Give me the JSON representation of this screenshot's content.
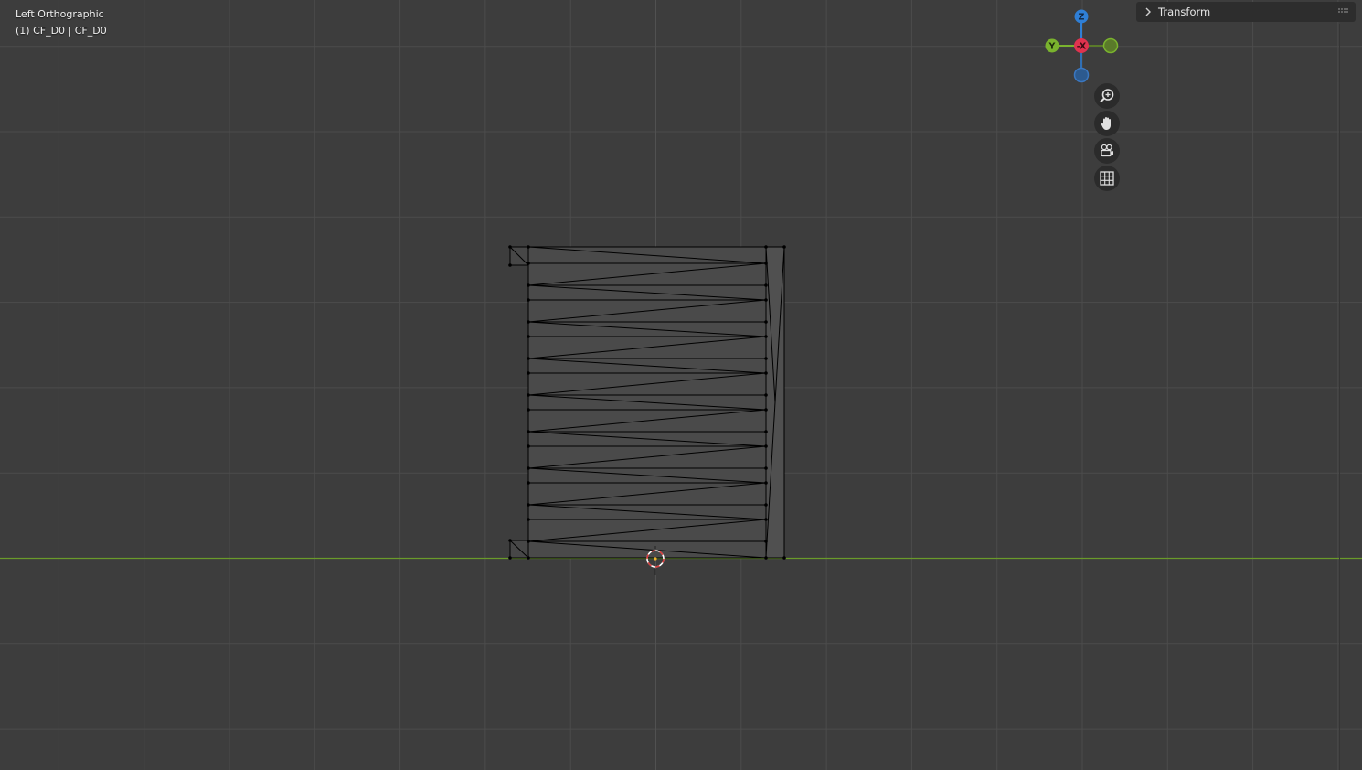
{
  "viewport": {
    "view_name": "Left Orthographic",
    "object_info": "(1) CF_D0 | CF_D0"
  },
  "gizmo": {
    "z_label": "Z",
    "y_label": "Y",
    "x_label": "-X",
    "colors": {
      "z": "#2f7fd6",
      "y": "#7ab32e",
      "x": "#e0334f",
      "neg_y": "#5a7a2a",
      "neg_z": "#2c5a8f"
    }
  },
  "nav_buttons": [
    {
      "name": "zoom-icon"
    },
    {
      "name": "pan-hand-icon"
    },
    {
      "name": "camera-icon"
    },
    {
      "name": "ortho-grid-icon"
    }
  ],
  "sidebar": {
    "panel_label": "Transform"
  },
  "colors": {
    "background": "#3d3d3d",
    "grid_minor": "#444444",
    "grid_major": "#4c4c4c",
    "horizon_axis": "#6a9a2a",
    "mesh_face": "#4a4a4a",
    "mesh_edge": "#000000",
    "cursor_red": "#d33838"
  }
}
